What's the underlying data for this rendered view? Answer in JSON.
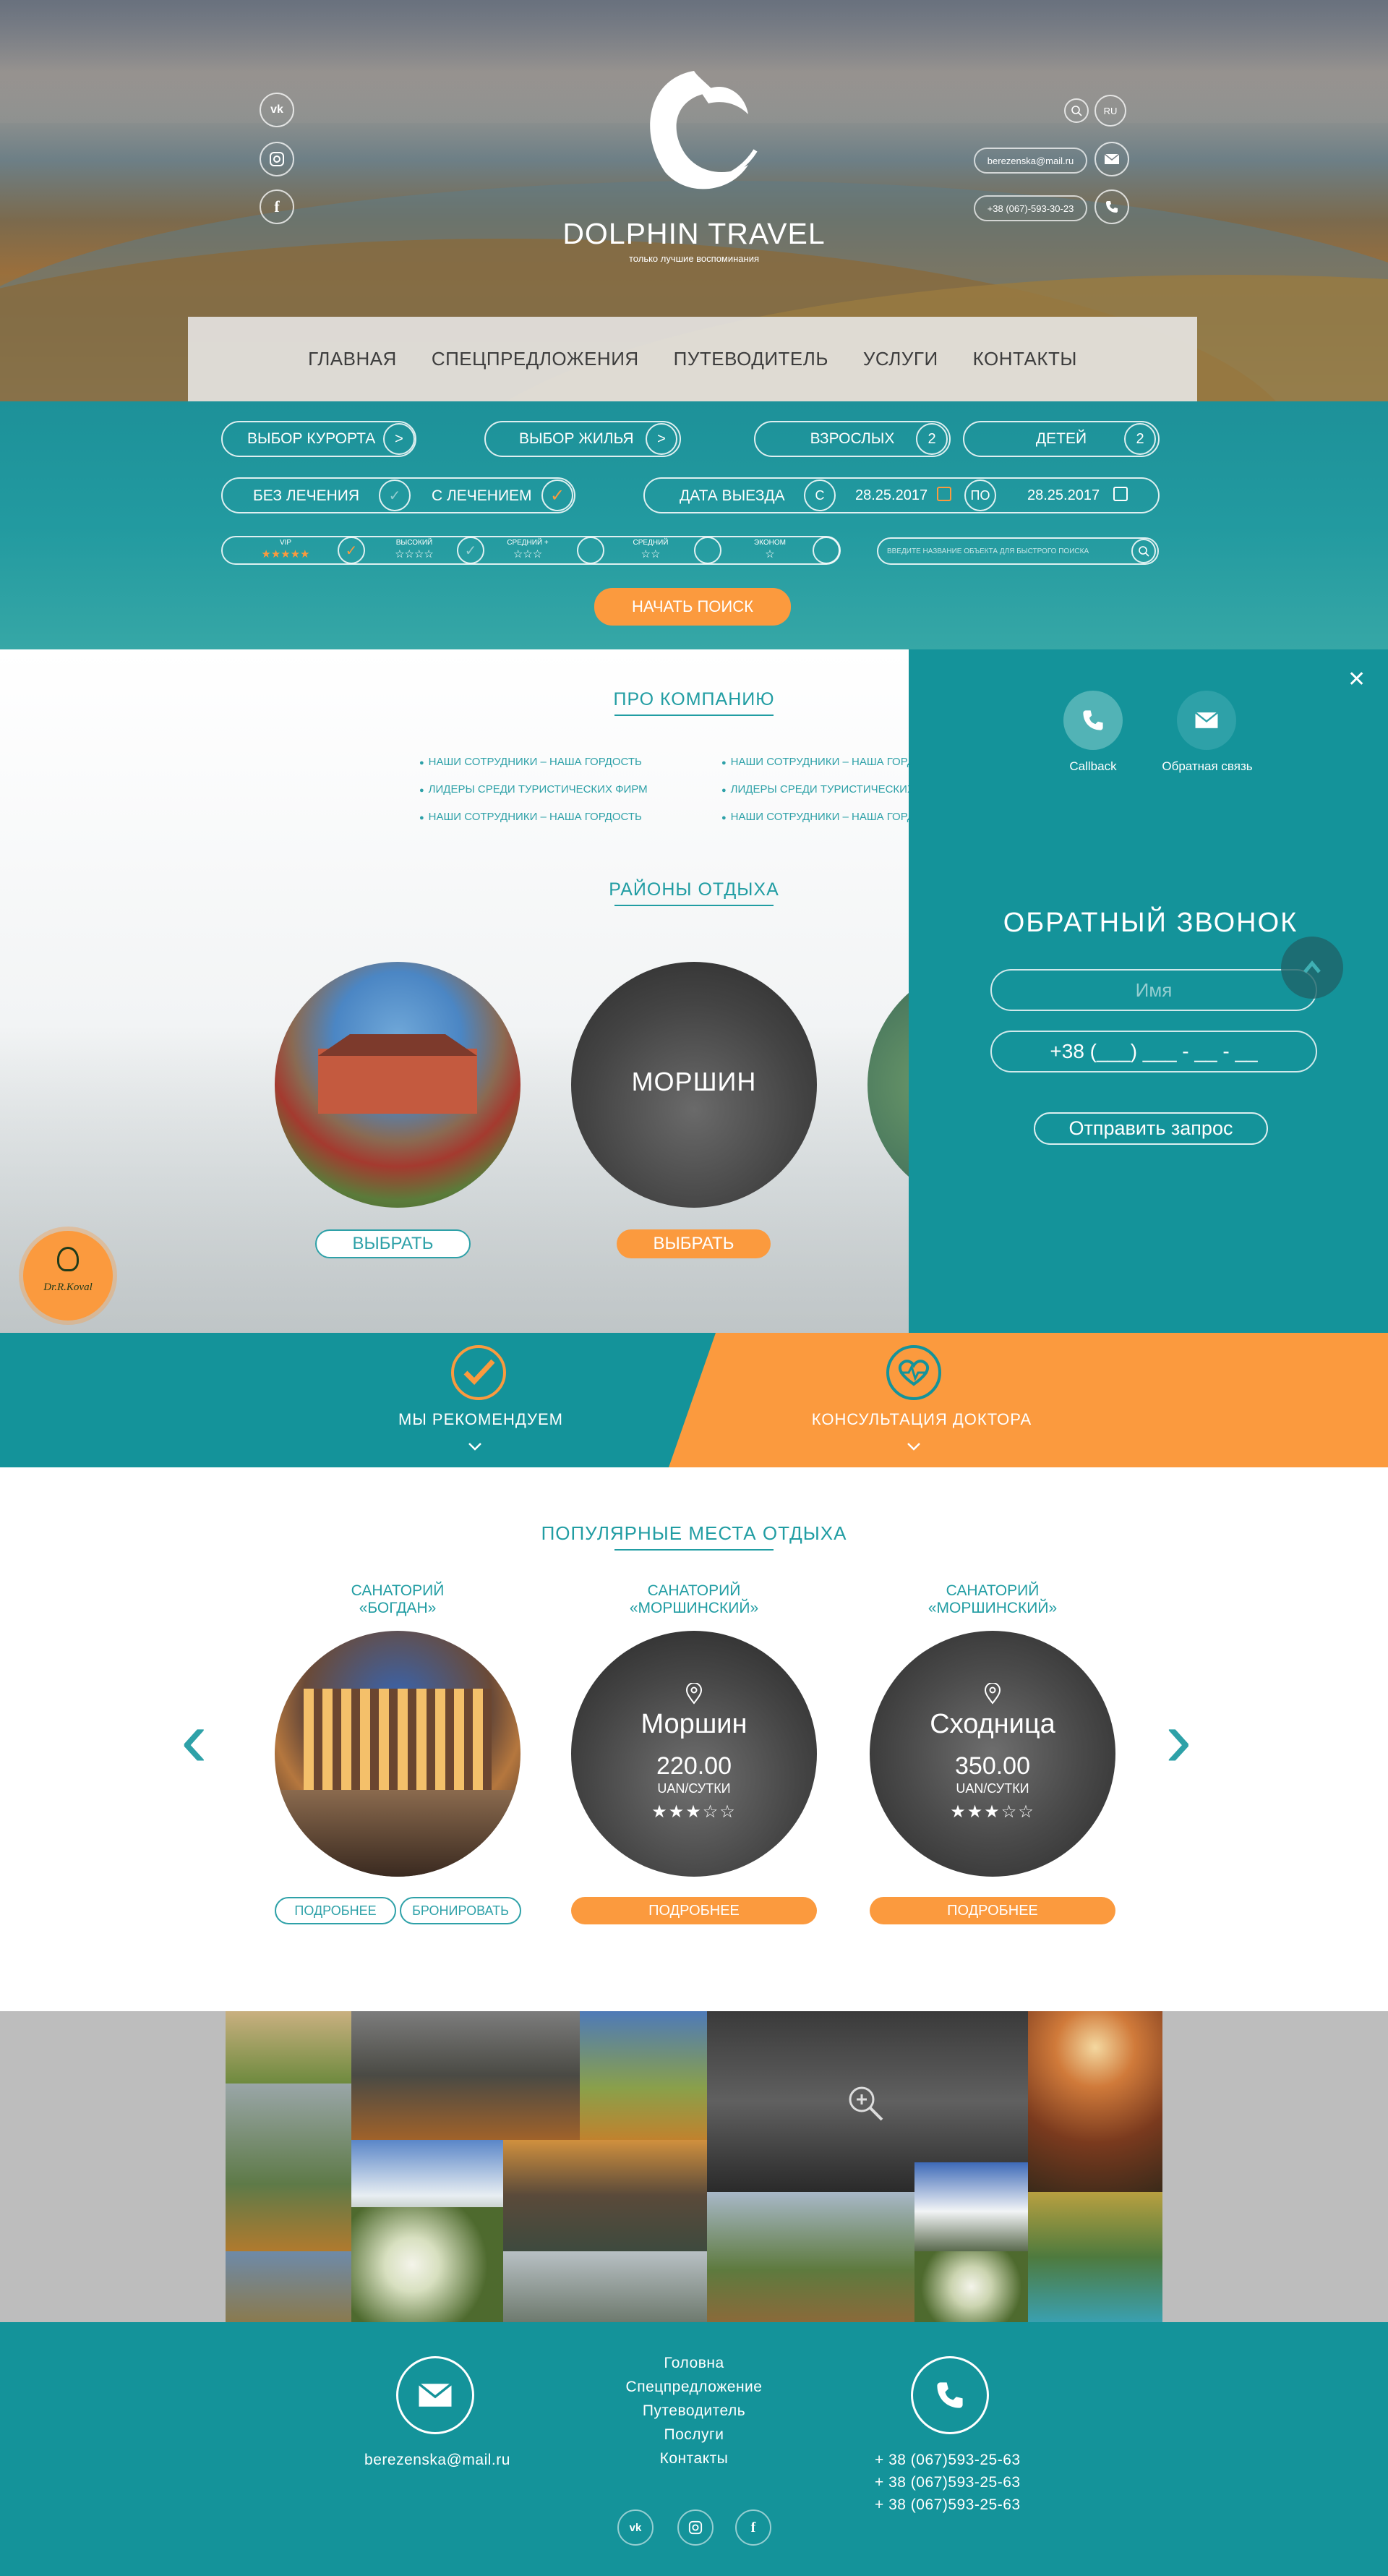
{
  "header": {
    "brand_name": "DOLPHIN TRAVEL",
    "tagline": "только лучшие воспоминания",
    "social_vk": "vk",
    "lang_current": "RU",
    "email": "berezenska@mail.ru",
    "phone": "+38 (067)-593-30-23"
  },
  "nav": {
    "items": [
      "ГЛАВНАЯ",
      "СПЕЦПРЕДЛОЖЕНИЯ",
      "ПУТЕВОДИТЕЛЬ",
      "УСЛУГИ",
      "КОНТАКТЫ"
    ]
  },
  "search": {
    "resort_label": "ВЫБОР КУРОРТА",
    "housing_label": "ВЫБОР ЖИЛЬЯ",
    "adults_label": "ВЗРОСЛЫХ",
    "adults_count": "2",
    "children_label": "ДЕТЕЙ",
    "children_count": "2",
    "arrow": ">",
    "no_treatment": "БЕЗ ЛЕЧЕНИЯ",
    "with_treatment": "С ЛЕЧЕНИЕМ",
    "departure_label": "ДАТА ВЫЕЗДА",
    "from_label": "С",
    "date_from": "28.25.2017",
    "to_label": "ПО",
    "date_to": "28.25.2017",
    "class_vip": "VIP",
    "class_high": "ВЫСОКИЙ",
    "class_mid_plus": "СРЕДНИЙ +",
    "class_mid": "СРЕДНИЙ",
    "class_econ": "ЭКОНОМ",
    "stars_vip": "★★★★★",
    "stars_high": "☆☆☆☆",
    "stars_mid_plus": "☆☆☆",
    "stars_mid": "☆☆",
    "stars_econ": "☆",
    "quick_search_placeholder": "ВВЕДИТЕ НАЗВАНИЕ ОБЪЕКТА ДЛЯ БЫСТРОГО ПОИСКА",
    "start_button": "НАЧАТЬ ПОИСК"
  },
  "company": {
    "title": "ПРО КОМПАНИЮ",
    "left_items": [
      "НАШИ СОТРУДНИКИ – НАША ГОРДОСТЬ",
      "ЛИДЕРЫ СРЕДИ ТУРИСТИЧЕСКИХ ФИРМ",
      "НАШИ СОТРУДНИКИ – НАША ГОРДОСТЬ"
    ],
    "right_items": [
      "НАШИ СОТРУДНИКИ – НАША ГОРДОСТЬ",
      "ЛИДЕРЫ СРЕДИ ТУРИСТИЧЕСКИХ ФИРМ",
      "НАШИ СОТРУДНИКИ – НАША ГОРДОСТЬ"
    ]
  },
  "regions": {
    "title": "РАЙОНЫ ОТДЫХА",
    "morshyn_label": "МОРШИН",
    "choose_label": "ВЫБРАТЬ"
  },
  "callback_panel": {
    "callback_label": "Callback",
    "feedback_label": "Обратная связь",
    "title": "ОБРАТНЫЙ ЗВОНОК",
    "name_placeholder": "Имя",
    "phone_placeholder": "+38 (___) ___ - __ - __",
    "submit": "Отправить запрос",
    "close": "✕"
  },
  "doctor_badge": "Dr.R.Koval",
  "features": {
    "recommend": "МЫ РЕКОМЕНДУЕМ",
    "doctor": "КОНСУЛЬТАЦИЯ ДОКТОРА"
  },
  "popular": {
    "title": "ПОПУЛЯРНЫЕ МЕСТА ОТДЫХА",
    "cards": [
      {
        "type": "САНАТОРИЙ",
        "name": "«БОГДАН»",
        "btn_more": "ПОДРОБНЕЕ",
        "btn_book": "БРОНИРОВАТЬ"
      },
      {
        "type": "САНАТОРИЙ",
        "name": "«МОРШИНСКИЙ»",
        "city": "Моршин",
        "price": "220.00",
        "unit": "UAN/СУТКИ",
        "stars": "★★★☆☆",
        "btn_more": "ПОДРОБНЕЕ"
      },
      {
        "type": "САНАТОРИЙ",
        "name": "«МОРШИНСКИЙ»",
        "city": "Сходница",
        "price": "350.00",
        "unit": "UAN/СУТКИ",
        "stars": "★★★☆☆",
        "btn_more": "ПОДРОБНЕЕ"
      }
    ],
    "prev": "‹",
    "next": "›"
  },
  "footer": {
    "email": "berezenska@mail.ru",
    "links": [
      "Головна",
      "Спецпредложение",
      "Путеводитель",
      "Послуги",
      "Контакты"
    ],
    "phones": [
      "+ 38 (067)593-25-63",
      "+ 38 (067)593-25-63",
      "+ 38 (067)593-25-63"
    ]
  },
  "colors": {
    "teal": "#14939a",
    "orange": "#fb9a3e",
    "text_teal": "#219da3"
  }
}
